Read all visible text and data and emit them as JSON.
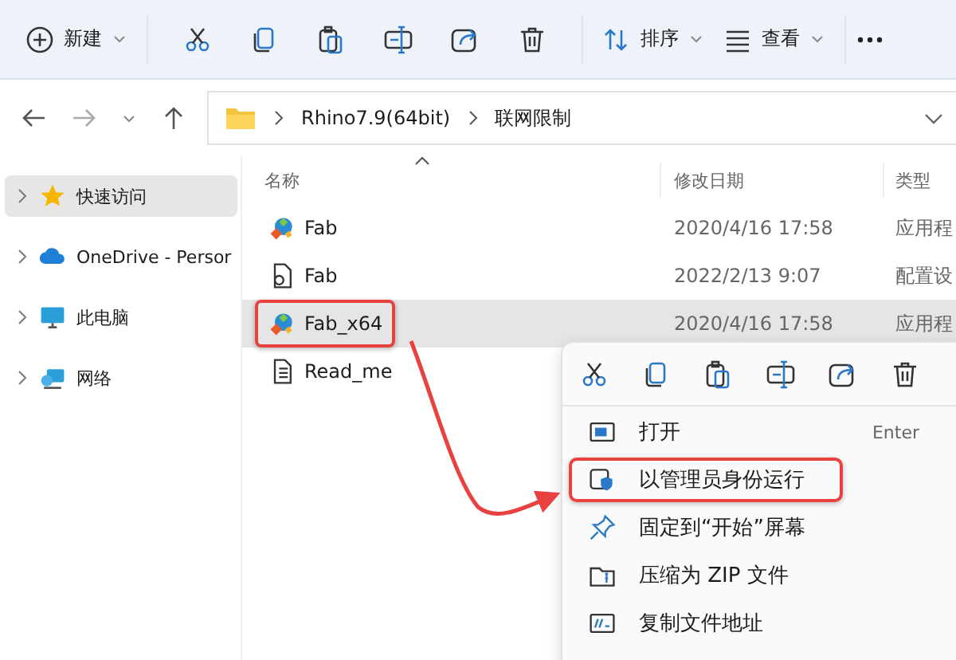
{
  "toolbar": {
    "new_button": "新建",
    "actions": [
      {
        "kind": "cut"
      },
      {
        "kind": "copy"
      },
      {
        "kind": "paste"
      },
      {
        "kind": "rename"
      },
      {
        "kind": "share"
      },
      {
        "kind": "delete"
      }
    ],
    "sort_button": "排序",
    "view_button": "查看"
  },
  "address_bar": {
    "breadcrumbs": [
      "Rhino7.9(64bit)",
      "联网限制"
    ]
  },
  "sidebar": {
    "items": [
      {
        "label": "快速访问",
        "kind": "star",
        "selected": true
      },
      {
        "label": "OneDrive - Persor",
        "kind": "cloud",
        "selected": false
      },
      {
        "label": "此电脑",
        "kind": "monitor",
        "selected": false
      },
      {
        "label": "网络",
        "kind": "network",
        "selected": false
      }
    ]
  },
  "table": {
    "columns": [
      "名称",
      "修改日期",
      "类型"
    ],
    "rows": [
      {
        "name": "Fab",
        "date": "2020/4/16 17:58",
        "type": "应用程",
        "kind": "app",
        "selected": false,
        "annotated": false
      },
      {
        "name": "Fab",
        "date": "2022/2/13 9:07",
        "type": "配置设",
        "kind": "config",
        "selected": false,
        "annotated": false
      },
      {
        "name": "Fab_x64",
        "date": "2020/4/16 17:58",
        "type": "应用程",
        "kind": "app",
        "selected": true,
        "annotated": true
      },
      {
        "name": "Read_me",
        "kind": "text",
        "selected": false,
        "annotated": false
      }
    ]
  },
  "context_menu": {
    "actions": [
      {
        "kind": "cut"
      },
      {
        "kind": "copy"
      },
      {
        "kind": "paste"
      },
      {
        "kind": "rename"
      },
      {
        "kind": "share"
      },
      {
        "kind": "delete"
      }
    ],
    "items": [
      {
        "label": "打开",
        "shortcut": "Enter",
        "kind": "open",
        "annotated": false
      },
      {
        "label": "以管理员身份运行",
        "kind": "shield",
        "annotated": true
      },
      {
        "label": "固定到“开始”屏幕",
        "kind": "pin",
        "annotated": false
      },
      {
        "label": "压缩为 ZIP 文件",
        "kind": "zip",
        "annotated": false
      },
      {
        "label": "复制文件地址",
        "kind": "path",
        "annotated": false
      }
    ]
  }
}
